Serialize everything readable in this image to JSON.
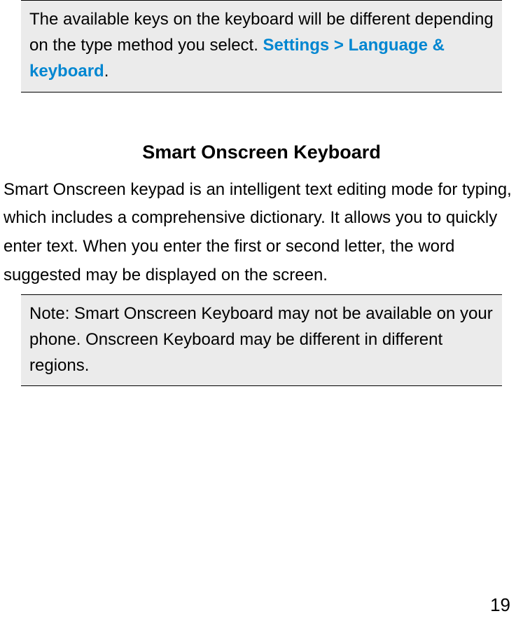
{
  "topNote": {
    "text1": "The available keys on the keyboard will be different depending on the type method you select.",
    "linkText": "Settings > Language & keyboard",
    "period": ".",
    "space": " "
  },
  "section": {
    "heading": "Smart Onscreen Keyboard",
    "body": "Smart Onscreen keypad is an intelligent text editing mode for typing, which includes a comprehensive dictionary. It allows you to quickly enter text. When you enter the first or second letter, the word suggested may be displayed on the screen."
  },
  "secondNote": {
    "text": "Note: Smart Onscreen Keyboard may not be available on your phone. Onscreen Keyboard may be different in different regions."
  },
  "pageNumber": "19"
}
